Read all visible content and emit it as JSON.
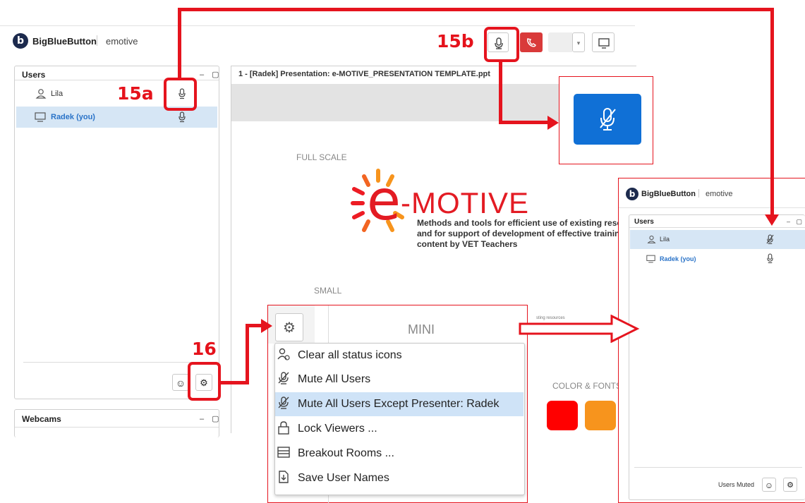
{
  "app": {
    "logo_letter": "b",
    "brand": "BigBlueButton",
    "room": "emotive"
  },
  "toolbar": {
    "mic_icon": "microphone-icon",
    "phone_icon": "phone-icon",
    "dropdown_arrow": "▾",
    "screen_icon": "desktop-icon"
  },
  "users_panel": {
    "title": "Users",
    "controls": "– ▢",
    "users": [
      {
        "name": "Lila",
        "icon": "user-icon",
        "mic": "microphone-icon"
      },
      {
        "name": "Radek (you)",
        "icon": "presenter-icon",
        "mic": "microphone-icon"
      }
    ]
  },
  "webcams_panel": {
    "title": "Webcams",
    "controls": "– ▢"
  },
  "presentation": {
    "title": "1 - [Radek] Presentation: e-MOTIVE_PRESENTATION TEMPLATE.ppt",
    "full_scale_label": "FULL SCALE",
    "logo_e": "e",
    "logo_rest": "-MOTIVE",
    "tagline_1": "Methods and tools for efficient use of existing resource",
    "tagline_2": "and for support of development of effective training",
    "tagline_3": "content by VET Teachers",
    "small_label": "SMALL",
    "mini_label": "MINI",
    "small_caption": "sting resources",
    "color_fonts_label": "COLOR & FONTS",
    "swatches": [
      "#ff0000",
      "#f7941d"
    ]
  },
  "callouts": {
    "a": "15a",
    "b": "15b",
    "c": "16"
  },
  "settings_menu": {
    "items": [
      {
        "label": "Clear all status icons",
        "icon": "clear-status-icon"
      },
      {
        "label": "Mute All Users",
        "icon": "mute-icon"
      },
      {
        "label": "Mute All Users Except Presenter: Radek",
        "icon": "mute-icon",
        "selected": true
      },
      {
        "label": "Lock Viewers ...",
        "icon": "lock-icon"
      },
      {
        "label": "Breakout Rooms ...",
        "icon": "breakout-icon"
      },
      {
        "label": "Save User Names",
        "icon": "save-icon"
      }
    ]
  },
  "result_panel": {
    "brand": "BigBlueButton",
    "room": "emotive",
    "users_title": "Users",
    "controls": "– ▢",
    "users": [
      {
        "name": "Lila",
        "icon": "user-icon",
        "mic": "muted-microphone-icon"
      },
      {
        "name": "Radek (you)",
        "icon": "presenter-icon",
        "mic": "microphone-icon"
      }
    ],
    "status": "Users Muted"
  },
  "colors": {
    "accent_red": "#e5141e",
    "brand_blue": "#2a73c8",
    "selection_blue": "#cfe3f7",
    "mute_button_blue": "#1070d6"
  }
}
